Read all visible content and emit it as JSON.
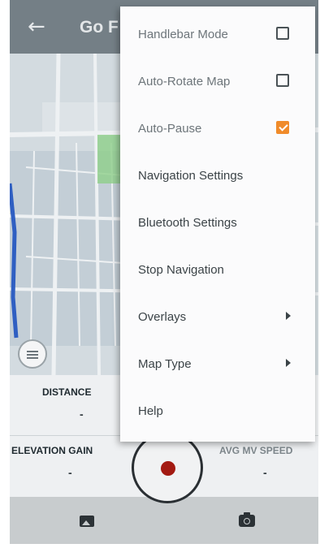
{
  "app_bar": {
    "back_icon": "arrow-left-icon",
    "title": "Go F"
  },
  "map": {
    "list_button_icon": "list-icon"
  },
  "stats": {
    "distance_label": "DISTANCE",
    "distance_value": "-",
    "elevation_label": "ELEVATION GAIN",
    "elevation_value": "-",
    "avg_speed_label": "AVG MV SPEED",
    "avg_speed_value": "-"
  },
  "bottom_bar": {
    "gallery_icon": "gallery-icon",
    "record_icon": "record-icon",
    "camera_icon": "camera-icon"
  },
  "menu": {
    "items": [
      {
        "label": "Handlebar Mode",
        "control": "checkbox",
        "checked": false
      },
      {
        "label": "Auto-Rotate Map",
        "control": "checkbox",
        "checked": false
      },
      {
        "label": "Auto-Pause",
        "control": "checkbox",
        "checked": true
      },
      {
        "label": "Navigation Settings",
        "control": "none"
      },
      {
        "label": "Bluetooth Settings",
        "control": "none"
      },
      {
        "label": "Stop Navigation",
        "control": "none"
      },
      {
        "label": "Overlays",
        "control": "submenu"
      },
      {
        "label": "Map Type",
        "control": "submenu"
      },
      {
        "label": "Help",
        "control": "none"
      }
    ]
  },
  "colors": {
    "accent_checkbox": "#f08b2a",
    "record_dot": "#a31a12",
    "app_bar": "#747f86"
  }
}
